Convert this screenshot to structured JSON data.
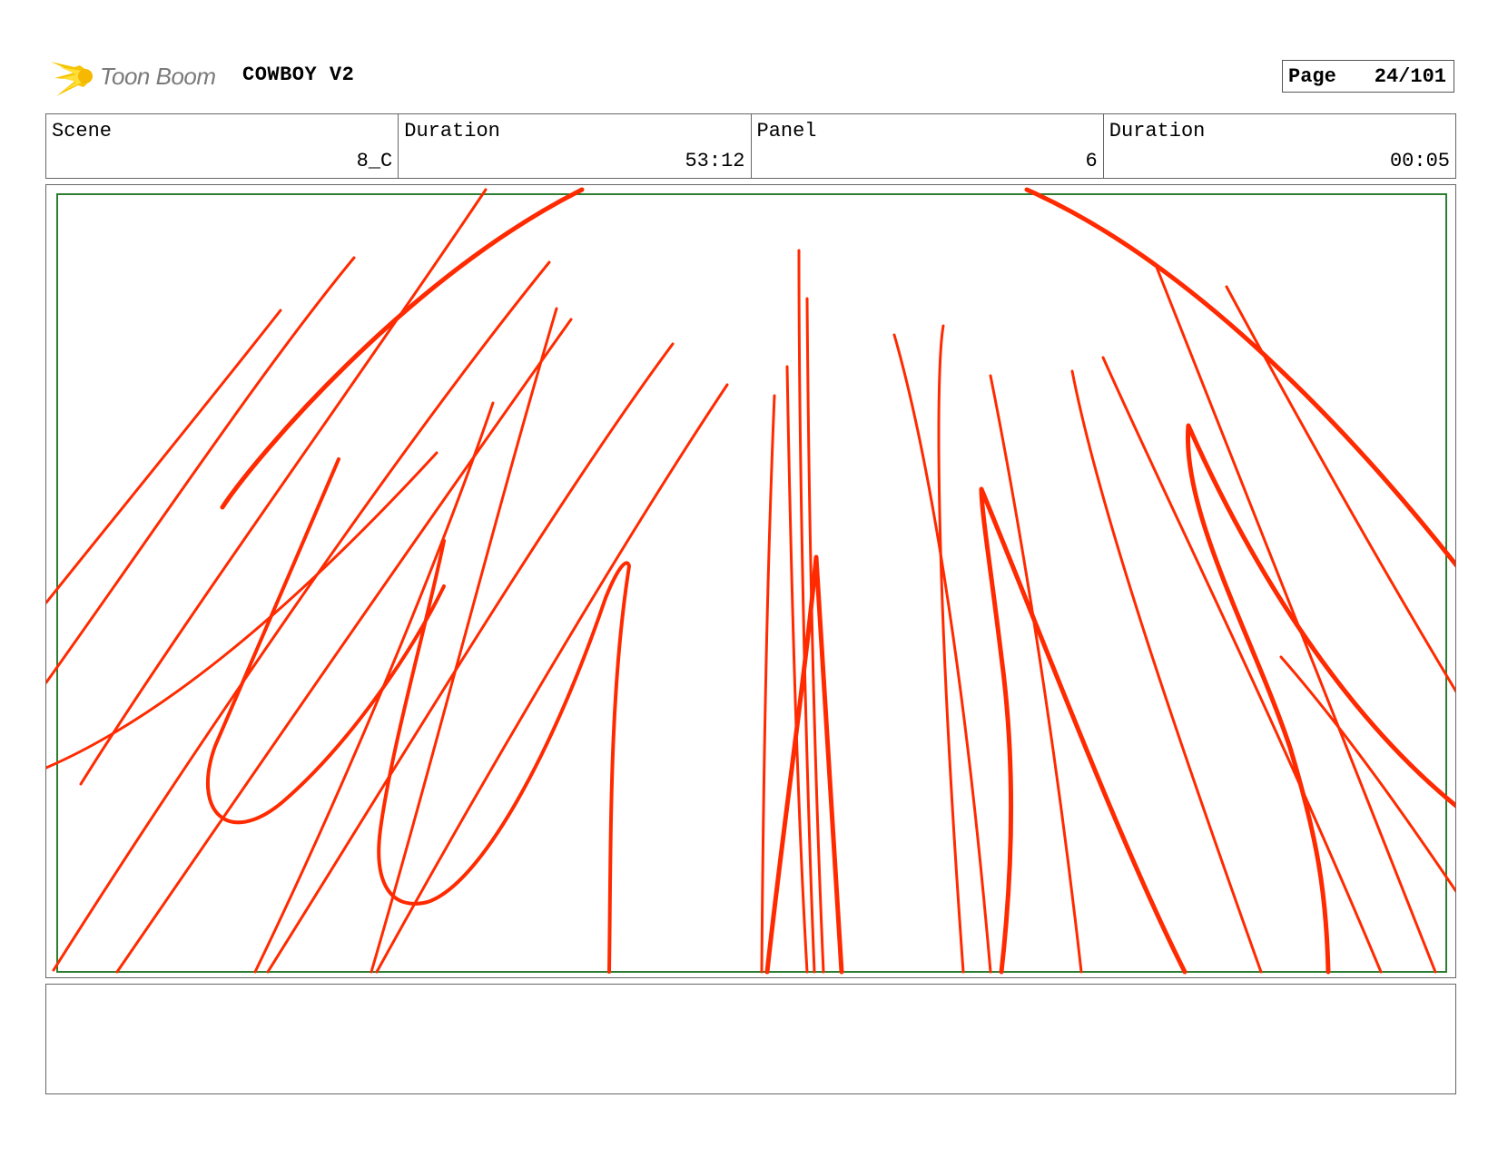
{
  "header": {
    "logo_text": "Toon Boom",
    "project_title": "COWBOY V2",
    "page_label": "Page",
    "page_value": "24/101"
  },
  "info": {
    "scene_label": "Scene",
    "scene_value": "8_C",
    "scene_duration_label": "Duration",
    "scene_duration_value": "53:12",
    "panel_label": "Panel",
    "panel_value": "6",
    "panel_duration_label": "Duration",
    "panel_duration_value": "00:05"
  },
  "drawing": {
    "safe_frame_color": "#2e7d32",
    "stroke_color": "#ff2a00",
    "content": "red-lines-sketch"
  },
  "notes": {
    "text": ""
  }
}
